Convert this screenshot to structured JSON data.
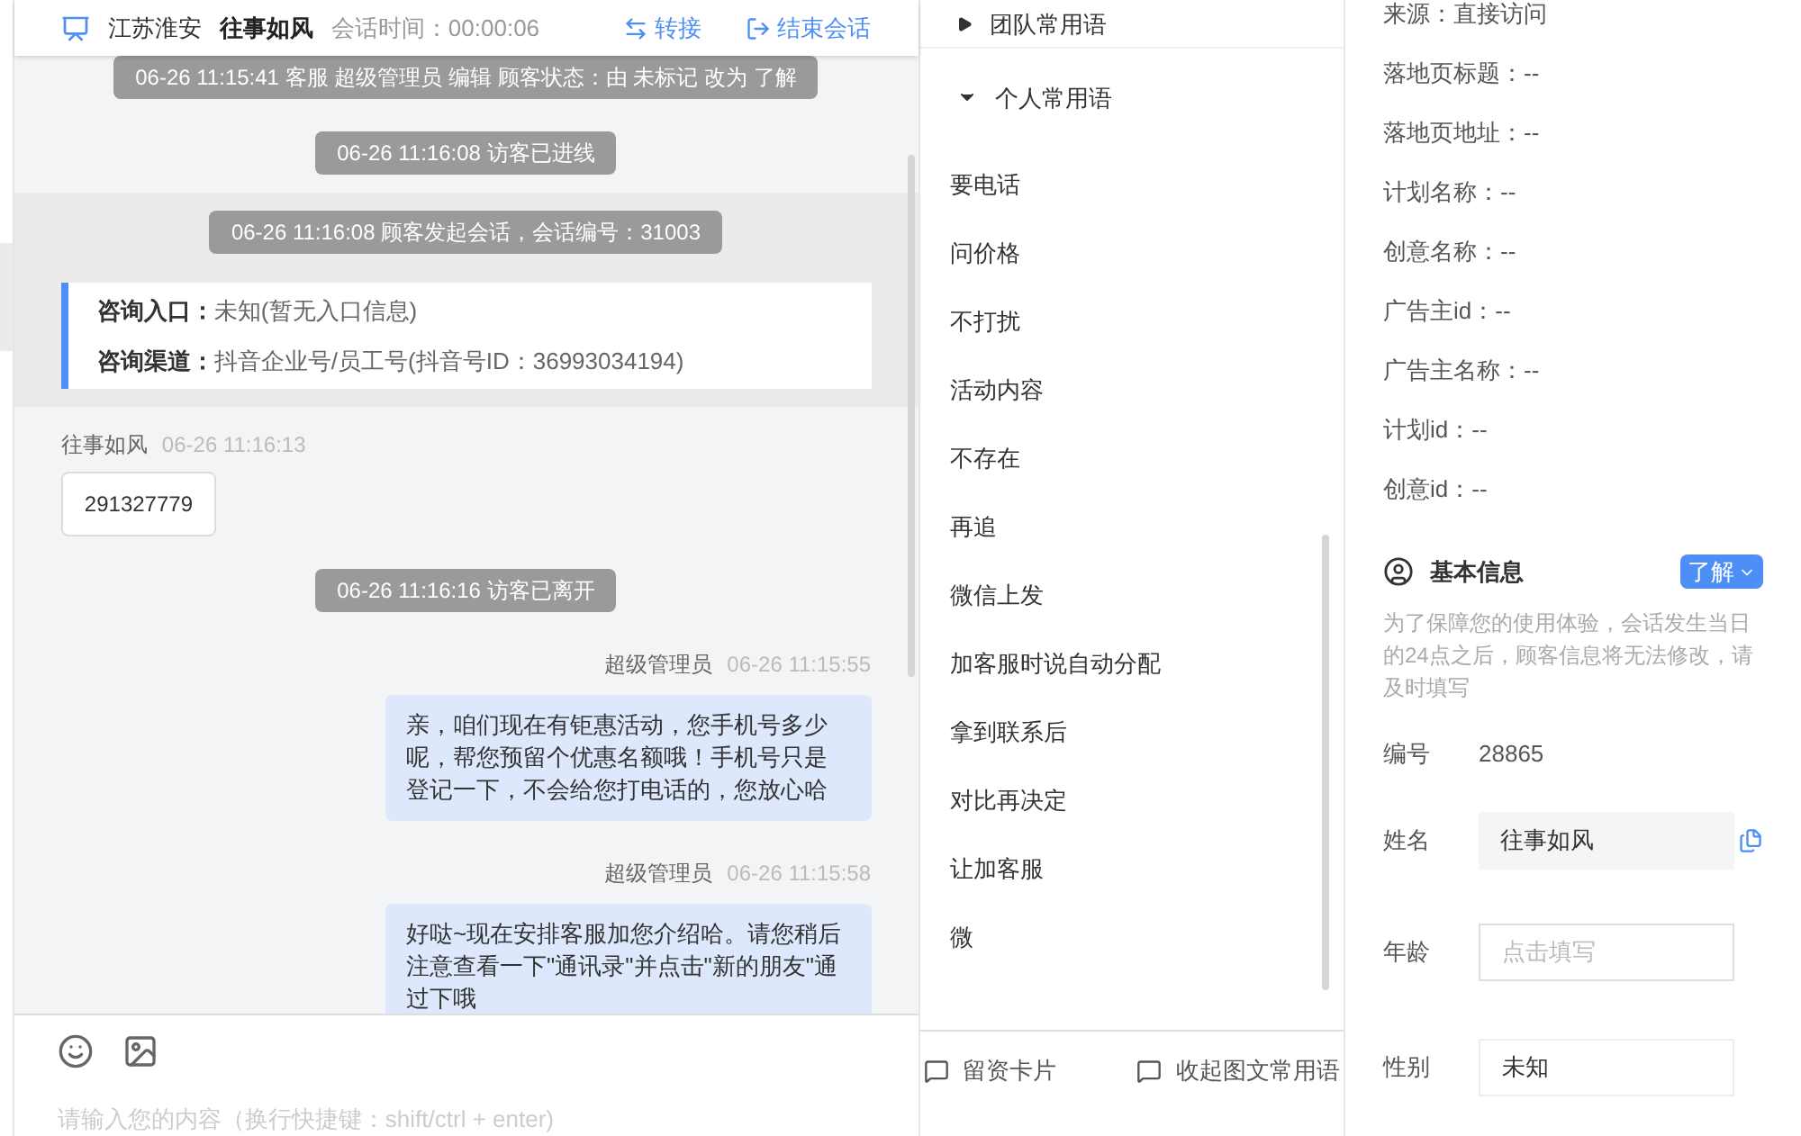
{
  "header": {
    "location": "江苏淮安",
    "visitor": "往事如风",
    "session_time": "会话时间：00:00:06",
    "actions": [
      {
        "kind": "transfer",
        "label": "转接"
      },
      {
        "kind": "end",
        "label": "结束会话"
      }
    ]
  },
  "messages": [
    {
      "kind": "system",
      "text": "06-26 11:15:41 客服 超级管理员 编辑 顾客状态：由 未标记 改为 了解"
    },
    {
      "kind": "system",
      "text": "06-26 11:16:08 访客已进线"
    },
    {
      "kind": "session",
      "text": "06-26 11:16:08 顾客发起会话，会话编号：31003",
      "info": [
        {
          "label": "咨询入口：",
          "value": "未知(暂无入口信息)"
        },
        {
          "label": "咨询渠道：",
          "value": "抖音企业号/员工号(抖音号ID：36993034194)"
        }
      ]
    },
    {
      "kind": "visitor",
      "name": "往事如风",
      "time": "06-26 11:16:13",
      "text": "291327779"
    },
    {
      "kind": "system",
      "text": "06-26 11:16:16 访客已离开"
    },
    {
      "kind": "agent",
      "name": "超级管理员",
      "time": "06-26 11:15:55",
      "text": "亲，咱们现在有钜惠活动，您手机号多少呢，帮您预留个优惠名额哦！手机号只是登记一下，不会给您打电话的，您放心哈"
    },
    {
      "kind": "agent",
      "name": "超级管理员",
      "time": "06-26 11:15:58",
      "text": "好哒~现在安排客服加您介绍哈。请您稍后注意查看一下\"通讯录\"并点击\"新的朋友\"通过下哦"
    }
  ],
  "composer": {
    "placeholder": "请输入您的内容（换行快捷键：shift/ctrl + enter)"
  },
  "phrase_groups": [
    {
      "label": "团队常用语",
      "expanded": false
    },
    {
      "label": "个人常用语",
      "expanded": true,
      "items": [
        "要电话",
        "问价格",
        "不打扰",
        "活动内容",
        "不存在",
        "再追",
        "微信上发",
        "加客服时说自动分配",
        "拿到联系后",
        "对比再决定",
        "让加客服",
        "微"
      ]
    }
  ],
  "phrase_actions": [
    "留资卡片",
    "收起图文常用语"
  ],
  "source_fields": [
    "来源：直接访问",
    "落地页标题：--",
    "落地页地址：--",
    "计划名称：--",
    "创意名称：--",
    "广告主id：--",
    "广告主名称：--",
    "计划id：--",
    "创意id：--"
  ],
  "basic_info": {
    "title": "基本信息",
    "status": "了解",
    "notice": "为了保障您的使用体验，会话发生当日的24点之后，顾客信息将无法修改，请及时填写",
    "fields": [
      {
        "kind": "text",
        "label": "编号",
        "value": "28865"
      },
      {
        "kind": "filled",
        "label": "姓名",
        "value": "往事如风"
      },
      {
        "kind": "empty",
        "label": "年龄",
        "placeholder": "点击填写"
      },
      {
        "kind": "select",
        "label": "性别",
        "value": "未知"
      }
    ]
  }
}
